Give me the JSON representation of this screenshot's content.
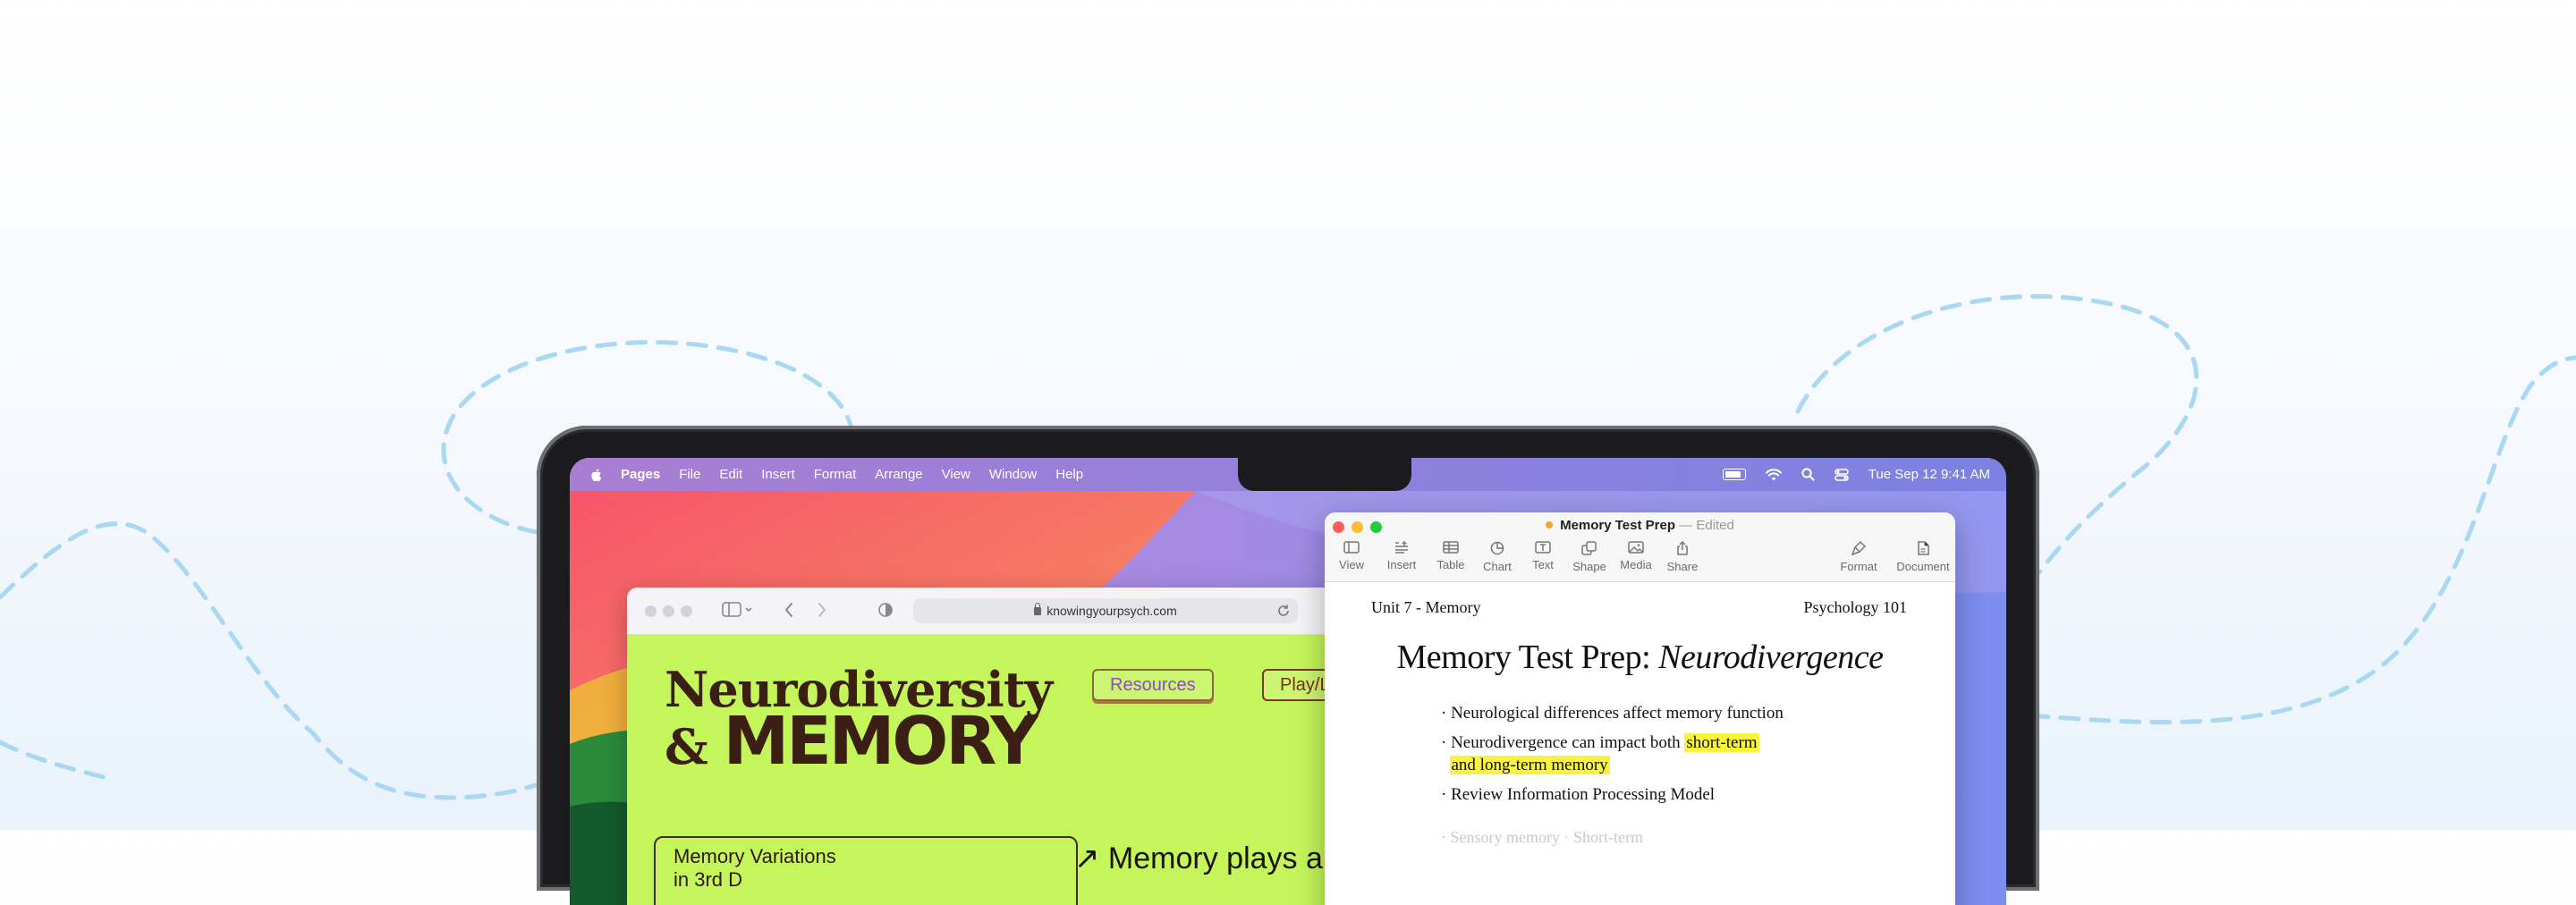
{
  "menubar": {
    "app": "Pages",
    "menus": [
      "File",
      "Edit",
      "Insert",
      "Format",
      "Arrange",
      "View",
      "Window",
      "Help"
    ],
    "datetime": "Tue Sep 12  9:41 AM"
  },
  "safari": {
    "url": "knowingyourpsych.com",
    "site_title_line1": "Neurodiversity",
    "site_title_line2_prefix": "&",
    "site_title_line2_word": "MEMORY",
    "nav": [
      "Resources",
      "Play/L"
    ],
    "subbox_line1": "Memory Variations",
    "subbox_line2": "in 3rd D",
    "tagline": "↗ Memory plays a"
  },
  "pages": {
    "doc_name": "Memory Test Prep",
    "separator": "—",
    "status": "Edited",
    "toolbar": [
      "View",
      "Insert",
      "Table",
      "Chart",
      "Text",
      "Shape",
      "Media",
      "Share"
    ],
    "toolbar_right": [
      "Format",
      "Document"
    ],
    "header_left": "Unit 7 - Memory",
    "header_right": "Psychology 101",
    "title_plain": "Memory Test Prep: ",
    "title_italic": "Neurodivergence",
    "bullets": [
      "· Neurological differences affect memory function",
      "· Neurodivergence can impact both ",
      "· Review Information Processing Model"
    ],
    "highlight_line1": "short-term",
    "highlight_line2": "and long-term memory",
    "faint_text": "· Sensory memory · Short-term"
  },
  "colors": {
    "safari_page_bg": "#c4f55a",
    "highlight": "#f8f33d",
    "dash_line": "#a9d8f2"
  }
}
